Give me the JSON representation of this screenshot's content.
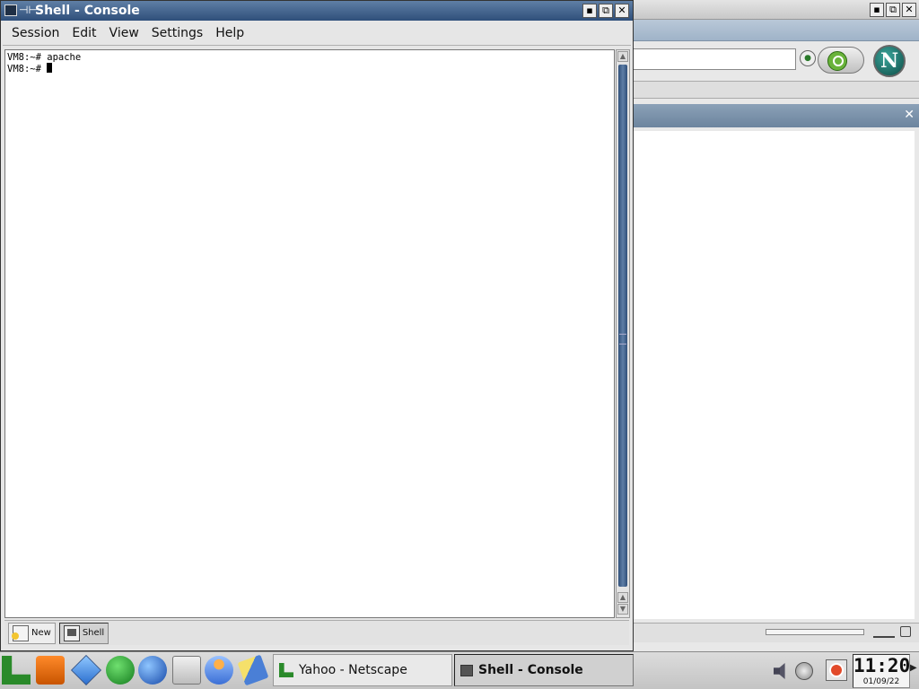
{
  "netscape_window": {
    "window_buttons": [
      "▪",
      "⧉",
      "✕"
    ],
    "logo_letter": "N",
    "sidebar_close": "✕"
  },
  "console": {
    "title": "Shell - Console",
    "title_pin": "⊣⊢",
    "window_buttons": [
      "▪",
      "⧉",
      "✕"
    ],
    "menu": [
      "Session",
      "Edit",
      "View",
      "Settings",
      "Help"
    ],
    "terminal_lines": [
      "VM8:~# apache",
      "VM8:~# "
    ],
    "tabs": [
      {
        "label": "New",
        "icon": "new-session-icon"
      },
      {
        "label": "Shell",
        "icon": "shell-icon"
      }
    ]
  },
  "taskbar": {
    "launchers": [
      "kmenu-icon",
      "life-vest-icon",
      "cube-icon",
      "runner-icon",
      "globe-icon",
      "drawer-icon",
      "person-icon",
      "pen-icon"
    ],
    "tasks": [
      {
        "label": "Yahoo - Netscape",
        "icon": "netscape-task-icon",
        "active": false
      },
      {
        "label": "Shell - Console",
        "icon": "console-task-icon",
        "active": true
      }
    ],
    "clock": {
      "time": "11:20",
      "date": "01/09/22"
    }
  }
}
